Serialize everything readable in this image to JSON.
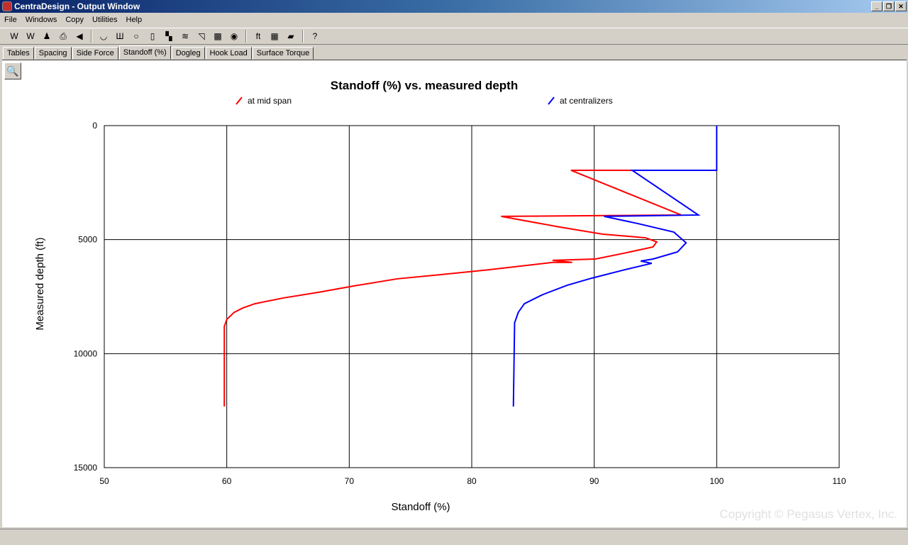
{
  "window": {
    "title": "CentraDesign - Output Window",
    "buttons": [
      "_",
      "❐",
      "✕"
    ]
  },
  "menu": [
    "File",
    "Windows",
    "Copy",
    "Utilities",
    "Help"
  ],
  "toolbar": [
    {
      "icon": "word-report-icon",
      "glyph": "W"
    },
    {
      "icon": "word-doc-icon",
      "glyph": "W"
    },
    {
      "icon": "joystick-icon",
      "glyph": "♟"
    },
    {
      "icon": "print-icon",
      "glyph": "⎙"
    },
    {
      "icon": "back-icon",
      "glyph": "◀"
    },
    {
      "sep": true
    },
    {
      "icon": "curve-icon",
      "glyph": "◡"
    },
    {
      "icon": "centralizer-icon",
      "glyph": "Ш"
    },
    {
      "icon": "circle-icon",
      "glyph": "○"
    },
    {
      "icon": "spacing-icon",
      "glyph": "▯"
    },
    {
      "icon": "wellpath-icon",
      "glyph": "▚"
    },
    {
      "icon": "plot-icon",
      "glyph": "≋"
    },
    {
      "icon": "graph-icon",
      "glyph": "◹"
    },
    {
      "icon": "gray-box-icon",
      "glyph": "▩"
    },
    {
      "icon": "color-wheel-icon",
      "glyph": "◉"
    },
    {
      "sep": true
    },
    {
      "icon": "unit-convert-icon",
      "glyph": "ft"
    },
    {
      "icon": "calculator-icon",
      "glyph": "▦"
    },
    {
      "icon": "book-icon",
      "glyph": "▰"
    },
    {
      "sep": true
    },
    {
      "icon": "help-icon",
      "glyph": "?"
    }
  ],
  "tabs": [
    {
      "label": "Tables"
    },
    {
      "label": "Spacing"
    },
    {
      "label": "Side Force"
    },
    {
      "label": "Standoff (%)",
      "active": true
    },
    {
      "label": "Dogleg"
    },
    {
      "label": "Hook Load"
    },
    {
      "label": "Surface Torque"
    }
  ],
  "zoom_button": "🔍",
  "watermark": "Copyright © Pegasus Vertex, Inc.",
  "chart_data": {
    "type": "line",
    "title": "Standoff (%) vs. measured depth",
    "xlabel": "Standoff (%)",
    "ylabel": "Measured depth (ft)",
    "xlim": [
      50,
      110
    ],
    "ylim": [
      0,
      15000
    ],
    "y_inverted": true,
    "grid": true,
    "xticks": [
      "50",
      "60",
      "70",
      "80",
      "90",
      "100",
      "110"
    ],
    "yticks": [
      "0",
      "5000",
      "10000",
      "15000"
    ],
    "legend": "top",
    "series": [
      {
        "name": "at mid span",
        "color": "#ff0000",
        "points": [
          [
            95.6,
            1960
          ],
          [
            88.1,
            1960
          ],
          [
            97.1,
            3920
          ],
          [
            82.4,
            3980
          ],
          [
            87.2,
            4450
          ],
          [
            90.7,
            4760
          ],
          [
            94.2,
            4920
          ],
          [
            95.1,
            5100
          ],
          [
            94.8,
            5320
          ],
          [
            92.4,
            5600
          ],
          [
            90.1,
            5850
          ],
          [
            86.6,
            5910
          ],
          [
            88.2,
            6000
          ],
          [
            86.6,
            6000
          ],
          [
            81.4,
            6320
          ],
          [
            77.4,
            6540
          ],
          [
            73.9,
            6720
          ],
          [
            70.4,
            7030
          ],
          [
            67.5,
            7310
          ],
          [
            64.6,
            7560
          ],
          [
            62.3,
            7810
          ],
          [
            61.3,
            8000
          ],
          [
            60.6,
            8190
          ],
          [
            60.0,
            8500
          ],
          [
            59.8,
            8810
          ],
          [
            59.8,
            12320
          ]
        ]
      },
      {
        "name": "at centralizers",
        "color": "#0000ff",
        "points": [
          [
            100,
            0
          ],
          [
            100,
            1960
          ],
          [
            93.1,
            1960
          ],
          [
            98.5,
            3920
          ],
          [
            90.8,
            3980
          ],
          [
            93.6,
            4300
          ],
          [
            96.5,
            4670
          ],
          [
            97.5,
            5140
          ],
          [
            96.8,
            5540
          ],
          [
            94.8,
            5850
          ],
          [
            93.8,
            5940
          ],
          [
            94.7,
            6040
          ],
          [
            92.5,
            6320
          ],
          [
            89.8,
            6690
          ],
          [
            87.8,
            7000
          ],
          [
            85.8,
            7410
          ],
          [
            84.3,
            7810
          ],
          [
            83.8,
            8190
          ],
          [
            83.5,
            8650
          ],
          [
            83.4,
            12320
          ]
        ]
      }
    ]
  }
}
